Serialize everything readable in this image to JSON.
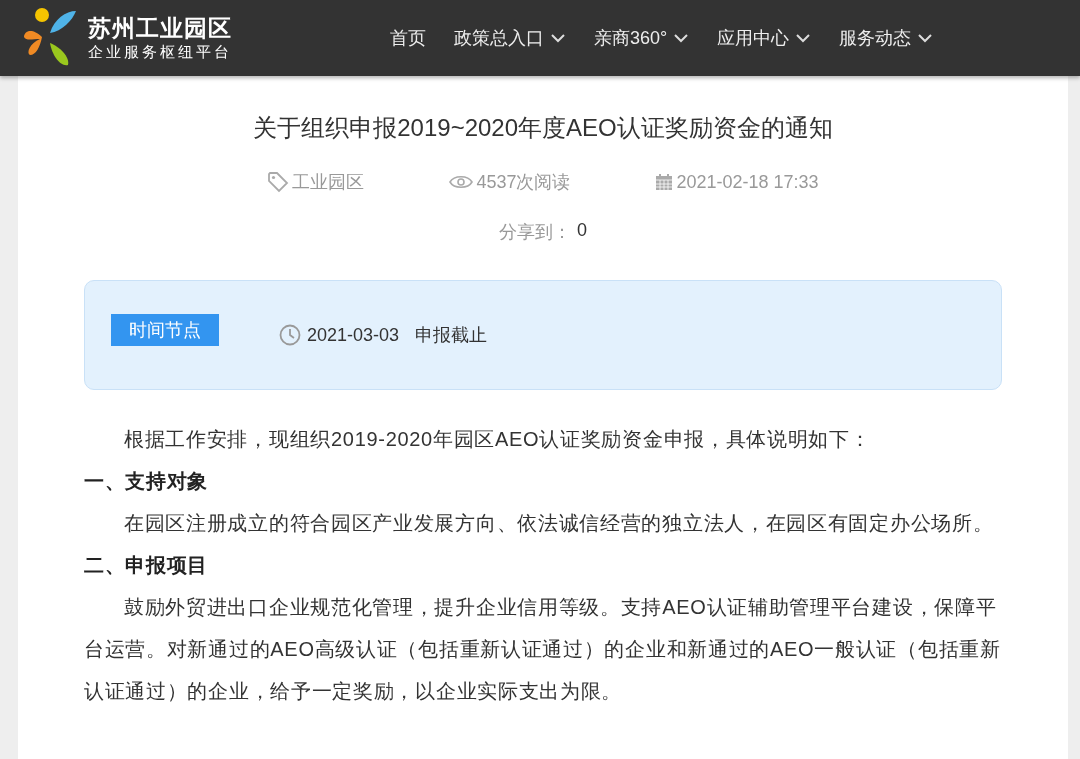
{
  "header": {
    "logo": {
      "title": "苏州工业园区",
      "subtitle": "企业服务枢纽平台"
    },
    "nav": [
      {
        "label": "首页",
        "dropdown": false
      },
      {
        "label": "政策总入口",
        "dropdown": true
      },
      {
        "label": "亲商360°",
        "dropdown": true
      },
      {
        "label": "应用中心",
        "dropdown": true
      },
      {
        "label": "服务动态",
        "dropdown": true
      }
    ]
  },
  "article": {
    "title": "关于组织申报2019~2020年度AEO认证奖励资金的通知",
    "meta": {
      "tag": "工业园区",
      "views": "4537次阅读",
      "date": "2021-02-18 17:33"
    },
    "share": {
      "label": "分享到：",
      "count": "0"
    },
    "timeline": {
      "badge": "时间节点",
      "date": "2021-03-03",
      "event": "申报截止"
    },
    "body": [
      {
        "kind": "paragraph",
        "text": "根据工作安排，现组织2019-2020年园区AEO认证奖励资金申报，具体说明如下："
      },
      {
        "kind": "heading",
        "text": "一、支持对象"
      },
      {
        "kind": "paragraph",
        "text": "在园区注册成立的符合园区产业发展方向、依法诚信经营的独立法人，在园区有固定办公场所。"
      },
      {
        "kind": "heading",
        "text": "二、申报项目"
      },
      {
        "kind": "paragraph",
        "text": "鼓励外贸进出口企业规范化管理，提升企业信用等级。支持AEO认证辅助管理平台建设，保障平台运营。对新通过的AEO高级认证（包括重新认证通过）的企业和新通过的AEO一般认证（包括重新认证通过）的企业，给予一定奖励，以企业实际支出为限。"
      }
    ]
  }
}
